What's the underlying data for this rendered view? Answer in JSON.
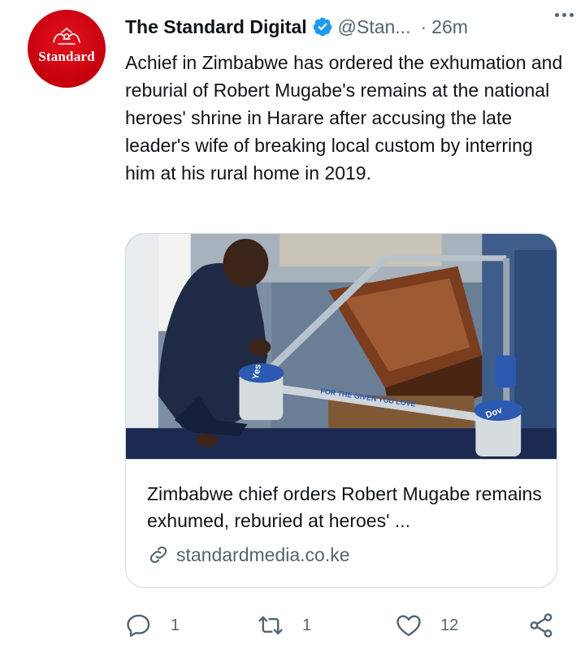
{
  "profile": {
    "avatar_text": "Standard",
    "display_name": "The Standard Digital",
    "handle": "@Stan...",
    "separator": "·",
    "timestamp": "26m"
  },
  "tweet": {
    "text": "Achief in Zimbabwe has ordered the exhumation and reburial of Robert Mugabe's remains at the national heroes' shrine in Harare after accusing the late leader's wife of breaking local custom by interring him at his rural home in 2019."
  },
  "card": {
    "title": "Zimbabwe chief orders Robert Mugabe remains exhumed, reburied at heroes' ...",
    "domain": "standardmedia.co.ke",
    "image_text": {
      "band_left": "Yes",
      "band_front": "FOR THE GIVEN YOU LOVE",
      "band_right": "Dov"
    }
  },
  "actions": {
    "reply_count": "1",
    "retweet_count": "1",
    "like_count": "12"
  },
  "colors": {
    "text_primary": "#0f1419",
    "text_secondary": "#536471",
    "verified": "#1d9bf0",
    "border": "#cfd9de",
    "avatar_red": "#c5000d"
  },
  "icons": [
    "verified-badge-icon",
    "more-options-icon",
    "link-icon",
    "reply-icon",
    "retweet-icon",
    "like-icon",
    "share-icon"
  ]
}
